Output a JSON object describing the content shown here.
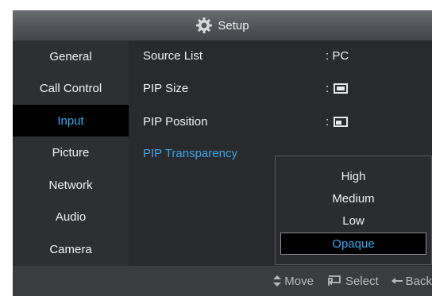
{
  "title": "Setup",
  "sidebar": {
    "items": [
      {
        "label": "General"
      },
      {
        "label": "Call Control"
      },
      {
        "label": "Input"
      },
      {
        "label": "Picture"
      },
      {
        "label": "Network"
      },
      {
        "label": "Audio"
      },
      {
        "label": "Camera"
      }
    ],
    "active": "Input"
  },
  "settings": {
    "source_list": {
      "label": "Source List",
      "value": ": PC"
    },
    "pip_size": {
      "label": "PIP Size",
      "value": ":"
    },
    "pip_position": {
      "label": "PIP Position",
      "value": ":"
    },
    "pip_transparency": {
      "label": "PIP Transparency"
    }
  },
  "dropdown": {
    "options": [
      "High",
      "Medium",
      "Low",
      "Opaque"
    ],
    "selected": "Opaque"
  },
  "footer": {
    "move": "Move",
    "select": "Select",
    "back": "Back"
  },
  "colors": {
    "accent": "#3aa4e8",
    "background": "#2b2c2f"
  },
  "icons": {
    "title": "gear-icon",
    "move": "updown-arrows-icon",
    "select": "enter-icon",
    "back": "back-arrow-icon"
  }
}
